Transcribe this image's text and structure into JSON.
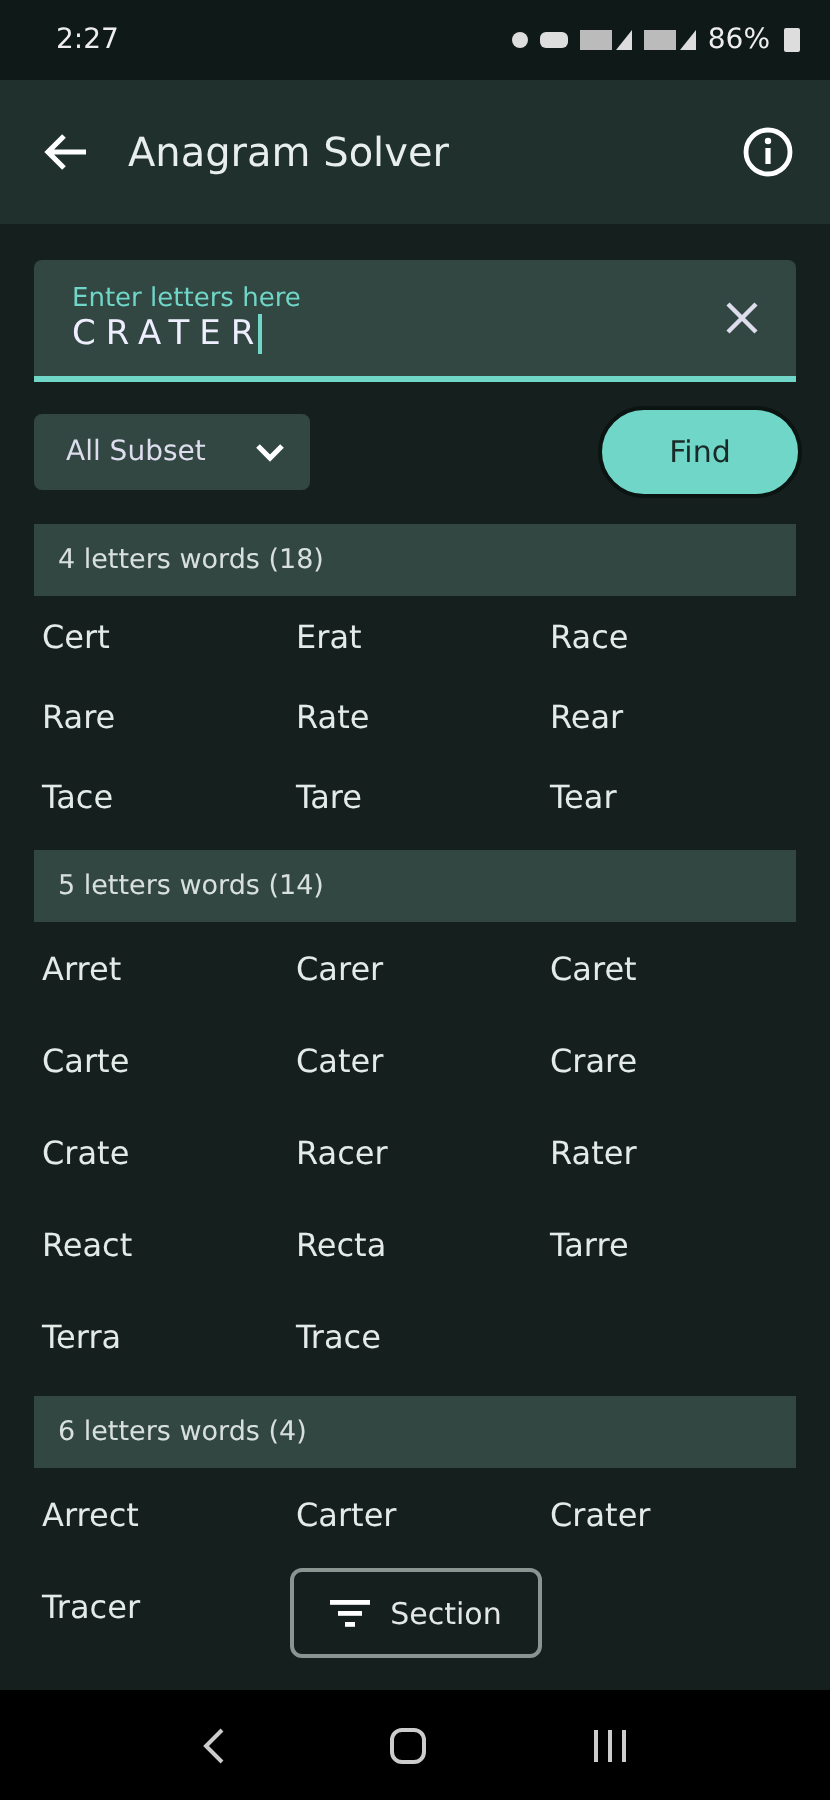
{
  "status_bar": {
    "time": "2:27",
    "battery": "86%"
  },
  "app_bar": {
    "title": "Anagram Solver"
  },
  "input": {
    "label": "Enter letters here",
    "value": "CRATER"
  },
  "filter": {
    "value": "All Subset"
  },
  "find_button": "Find",
  "sections": [
    {
      "title": "4 letters words (18)",
      "words": [
        "Cert",
        "Erat",
        "Race",
        "Rare",
        "Rate",
        "Rear",
        "Tace",
        "Tare",
        "Tear"
      ]
    },
    {
      "title": "5 letters words (14)",
      "words": [
        "Arret",
        "Carer",
        "Caret",
        "Carte",
        "Cater",
        "Crare",
        "Crate",
        "Racer",
        "Rater",
        "React",
        "Recta",
        "Tarre",
        "Terra",
        "Trace"
      ]
    },
    {
      "title": "6 letters words (4)",
      "words": [
        "Arrect",
        "Carter",
        "Crater",
        "Tracer"
      ]
    }
  ],
  "section_button": "Section"
}
